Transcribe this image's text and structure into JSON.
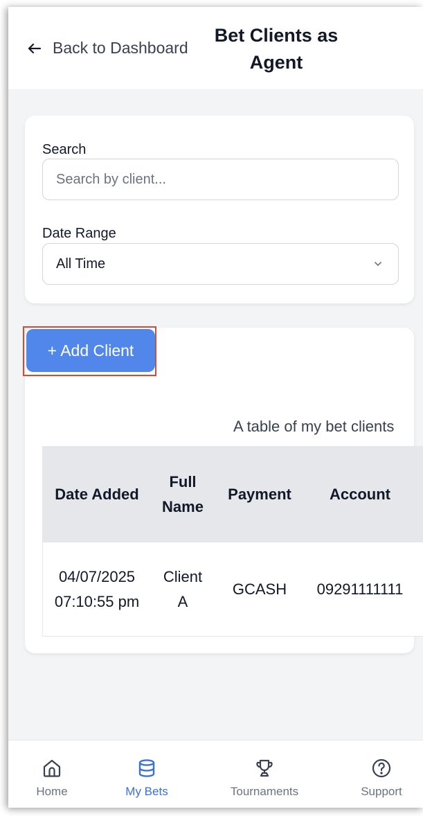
{
  "header": {
    "back_label": "Back to Dashboard",
    "title": "Bet Clients as Agent"
  },
  "filters": {
    "search_label": "Search",
    "search_placeholder": "Search by client...",
    "search_value": "",
    "date_label": "Date Range",
    "date_value": "All Time"
  },
  "clients": {
    "add_button": "+ Add Client",
    "caption": "A table of my bet clients",
    "columns": [
      "Date Added",
      "Full Name",
      "Payment",
      "Account"
    ],
    "rows": [
      [
        "04/07/2025 07:10:55 pm",
        "Client A",
        "GCASH",
        "09291111111"
      ]
    ]
  },
  "nav": {
    "items": [
      {
        "label": "Home",
        "icon": "home-icon",
        "active": false
      },
      {
        "label": "My Bets",
        "icon": "database-icon",
        "active": true
      },
      {
        "label": "Tournaments",
        "icon": "trophy-icon",
        "active": false
      },
      {
        "label": "Support",
        "icon": "help-circle-icon",
        "active": false
      }
    ]
  },
  "colors": {
    "accent": "#5186ea",
    "active_nav": "#3b6fe0",
    "highlight_border": "#e0452e",
    "page_bg": "#f3f4f6"
  }
}
